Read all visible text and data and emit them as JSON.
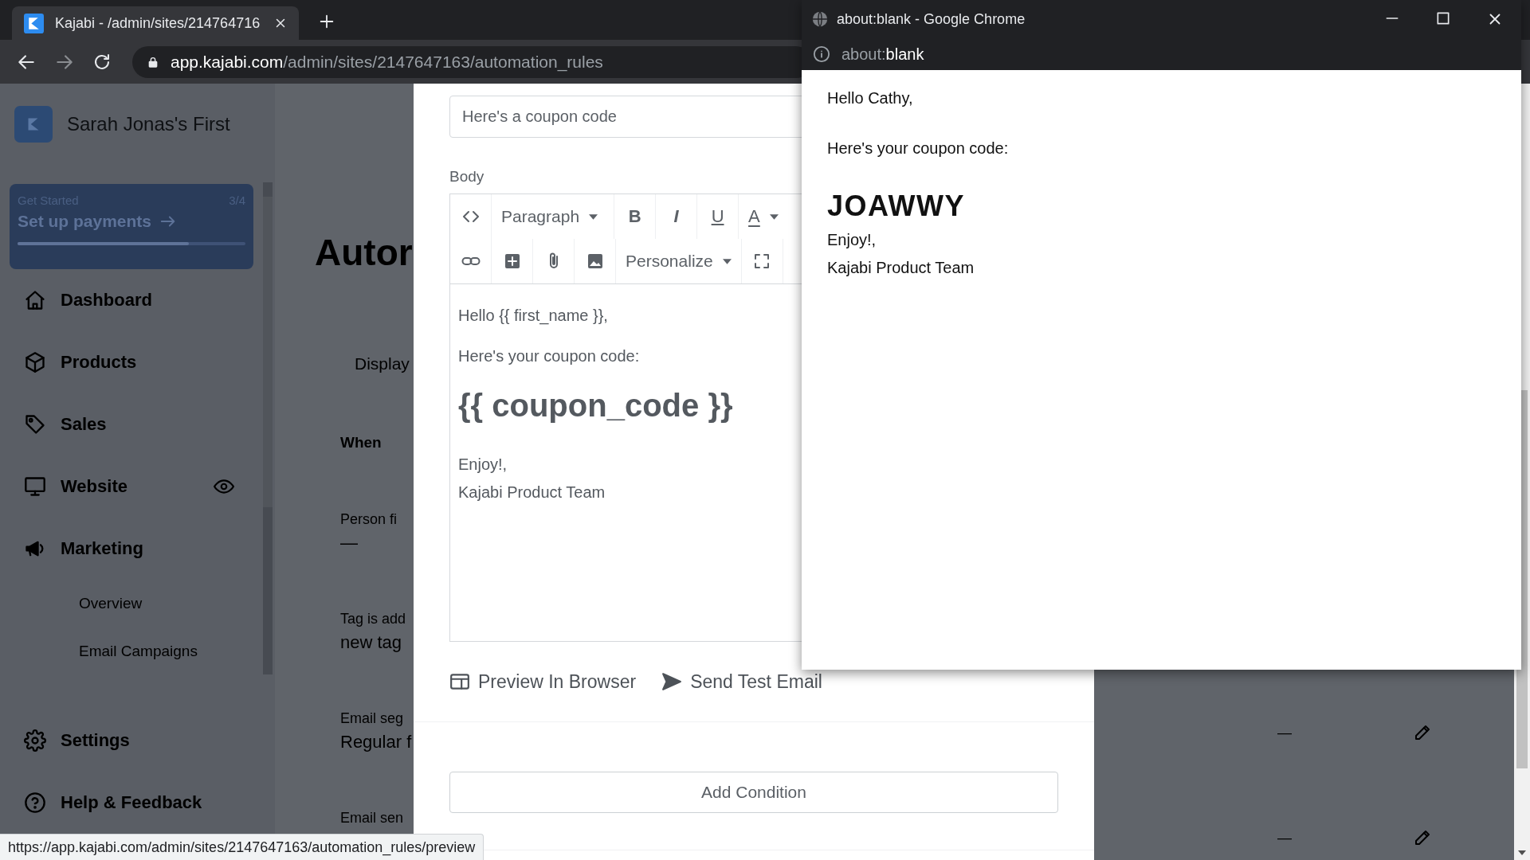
{
  "browser": {
    "tab": {
      "title": "Kajabi - /admin/sites/214764716",
      "selected": true
    },
    "url": {
      "host": "app.kajabi.com",
      "path": "/admin/sites/2147647163/automation_rules"
    }
  },
  "sidebar": {
    "site_name": "Sarah Jonas's First",
    "get_started": {
      "label": "Get Started",
      "count": "3/4",
      "action": "Set up payments",
      "level": 0.75
    },
    "items": [
      {
        "label": "Dashboard"
      },
      {
        "label": "Products"
      },
      {
        "label": "Sales"
      },
      {
        "label": "Website"
      },
      {
        "label": "Marketing",
        "expanded": true,
        "children": [
          {
            "label": "Overview"
          },
          {
            "label": "Email Campaigns"
          }
        ]
      }
    ],
    "footer_items": [
      {
        "label": "Settings"
      },
      {
        "label": "Help & Feedback"
      }
    ]
  },
  "background_page": {
    "heading": "Autor",
    "tab": "Display",
    "section": "When",
    "fields": [
      {
        "label": "Person fi",
        "value": "—"
      },
      {
        "label": "Tag is add",
        "value": "new tag"
      },
      {
        "label": "Email seg",
        "value": "Regular f"
      },
      {
        "label": "Email sen"
      }
    ],
    "side_rows": [
      {
        "value": "—"
      },
      {
        "value": "—"
      }
    ]
  },
  "modal": {
    "subject": "Here's a coupon code",
    "body_label": "Body",
    "toolbar": {
      "block_format": "Paragraph",
      "format_buttons": [
        "B",
        "I",
        "U",
        "A"
      ],
      "personalize": "Personalize"
    },
    "content": [
      {
        "kind": "paragraph",
        "text": "Hello {{ first_name }},"
      },
      {
        "kind": "paragraph",
        "text": "Here's your coupon code:"
      },
      {
        "kind": "heading",
        "text": "{{ coupon_code }}"
      },
      {
        "kind": "line",
        "text": "Enjoy!,"
      },
      {
        "kind": "line",
        "text": "Kajabi Product Team"
      }
    ],
    "actions": [
      "Preview In Browser",
      "Send Test Email"
    ],
    "add_condition": "Add Condition"
  },
  "popup": {
    "title": "about:blank - Google Chrome",
    "url": {
      "scheme": "about:",
      "rest": "blank"
    },
    "content": [
      {
        "kind": "paragraph",
        "text": "Hello Cathy,"
      },
      {
        "kind": "paragraph",
        "text": "Here's your coupon code:"
      },
      {
        "kind": "heading",
        "text": "JOAWWY"
      },
      {
        "kind": "line",
        "text": "Enjoy!,"
      },
      {
        "kind": "line",
        "text": "Kajabi Product Team"
      }
    ]
  },
  "status_url": "https://app.kajabi.com/admin/sites/2147647163/automation_rules/preview"
}
